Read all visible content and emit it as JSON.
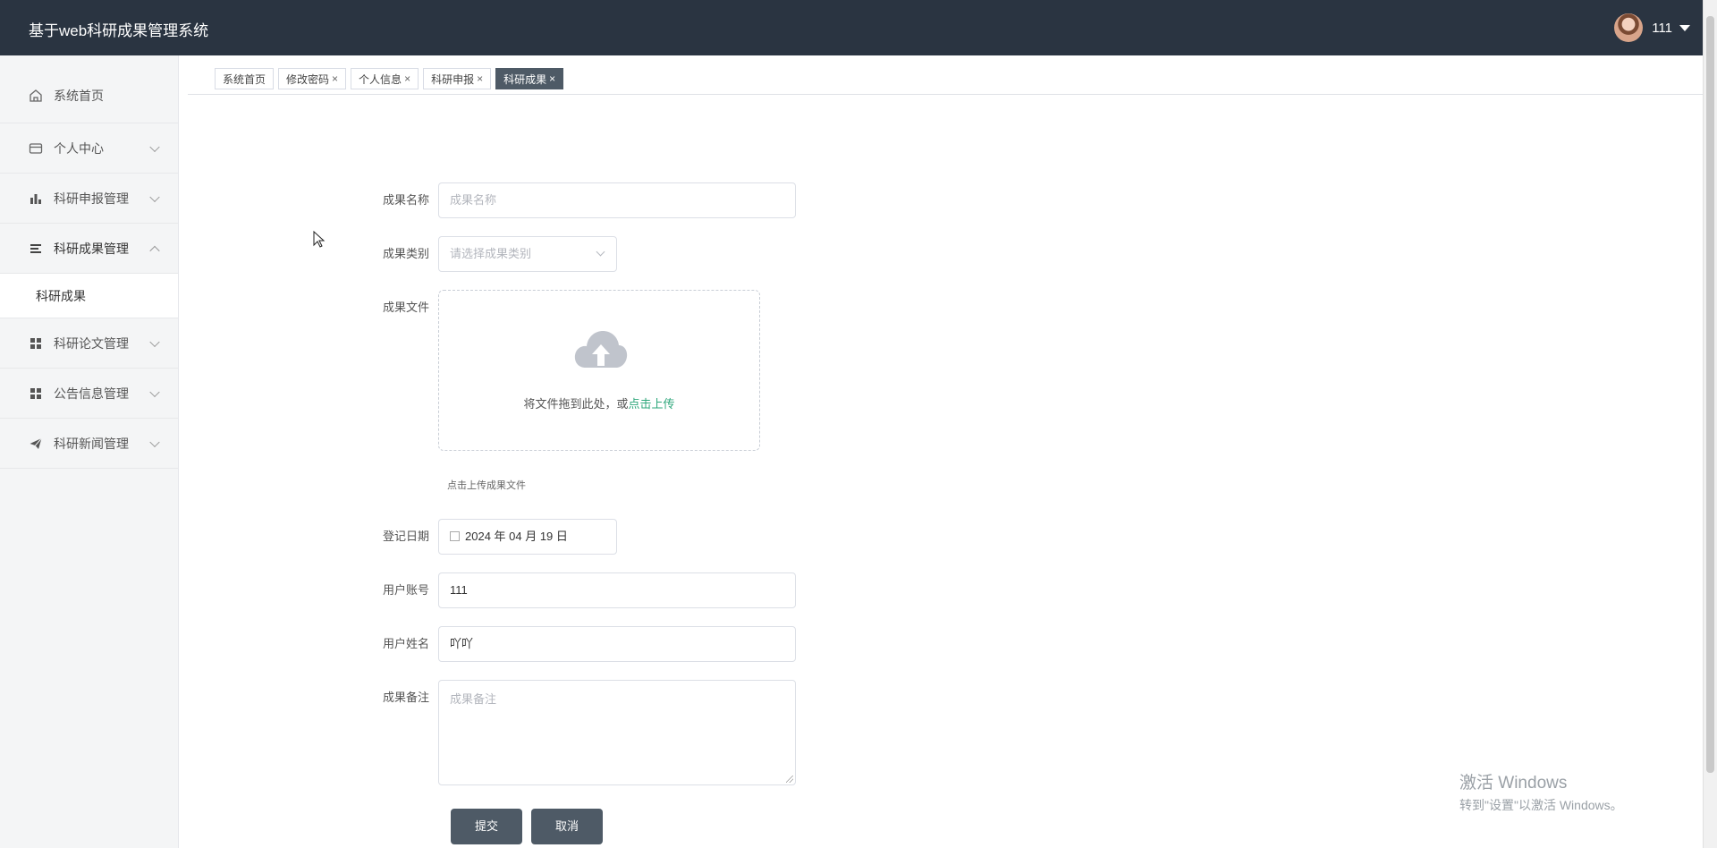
{
  "header": {
    "title": "基于web科研成果管理系统",
    "username": "111"
  },
  "sidebar": {
    "items": [
      {
        "label": "系统首页",
        "icon": "home-icon"
      },
      {
        "label": "个人中心",
        "icon": "wallet-icon"
      },
      {
        "label": "科研申报管理",
        "icon": "bar-chart-icon"
      },
      {
        "label": "科研成果管理",
        "icon": "menu-icon",
        "open": true
      },
      {
        "label": "科研论文管理",
        "icon": "grid-icon"
      },
      {
        "label": "公告信息管理",
        "icon": "grid-icon"
      },
      {
        "label": "科研新闻管理",
        "icon": "paper-plane-icon"
      }
    ],
    "submenu": {
      "label": "科研成果"
    }
  },
  "tabs": [
    {
      "label": "系统首页",
      "closable": false
    },
    {
      "label": "修改密码",
      "closable": true
    },
    {
      "label": "个人信息",
      "closable": true
    },
    {
      "label": "科研申报",
      "closable": true
    },
    {
      "label": "科研成果",
      "closable": true,
      "active": true
    }
  ],
  "tab_close_glyph": "×",
  "form": {
    "name": {
      "label": "成果名称",
      "placeholder": "成果名称"
    },
    "category": {
      "label": "成果类别",
      "placeholder": "请选择成果类别"
    },
    "file": {
      "label": "成果文件",
      "drop_text": "将文件拖到此处，或",
      "link_text": "点击上传",
      "tip": "点击上传成果文件"
    },
    "date": {
      "label": "登记日期",
      "value": "2024 年 04 月 19 日"
    },
    "account": {
      "label": "用户账号",
      "value": "111"
    },
    "username": {
      "label": "用户姓名",
      "value": "吖吖"
    },
    "remark": {
      "label": "成果备注",
      "placeholder": "成果备注"
    },
    "submit_label": "提交",
    "cancel_label": "取消"
  },
  "watermark": {
    "line1": "激活 Windows",
    "line2": "转到\"设置\"以激活 Windows。"
  }
}
